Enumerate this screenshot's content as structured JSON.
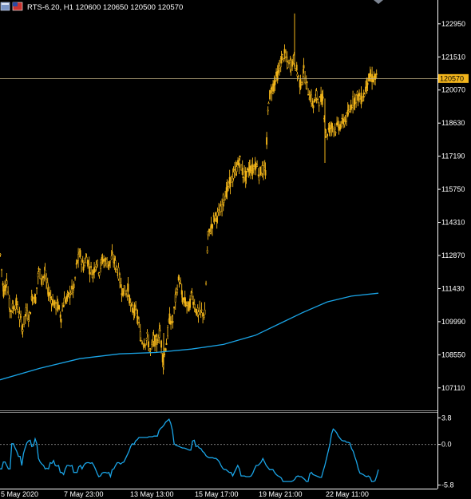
{
  "header": {
    "title": "RTS-6.20, H1  120600 120650 120500 120570",
    "icons": [
      "window-icon",
      "flag-icon"
    ]
  },
  "chart_data": [
    {
      "type": "candlestick",
      "symbol": "RTS-6.20",
      "timeframe": "H1",
      "ohlc": {
        "open": 120600,
        "high": 120650,
        "low": 120500,
        "close": 120570
      },
      "price_axis_ticks": [
        122950,
        121510,
        120070,
        118630,
        117190,
        115750,
        114310,
        112870,
        111430,
        109990,
        108550,
        107110
      ],
      "current_price_label": "120570",
      "current_price": 120570,
      "ylim": [
        106200,
        123500
      ],
      "x_labels": [
        "5 May 2020",
        "7 May 23:00",
        "13 May 13:00",
        "15 May 17:00",
        "19 May 21:00",
        "22 May 11:00"
      ],
      "close_path": [
        [
          0,
          112900
        ],
        [
          4,
          111300
        ],
        [
          8,
          111800
        ],
        [
          12,
          110500
        ],
        [
          16,
          110600
        ],
        [
          20,
          110800
        ],
        [
          24,
          110200
        ],
        [
          28,
          109700
        ],
        [
          32,
          110400
        ],
        [
          36,
          110200
        ],
        [
          40,
          111100
        ],
        [
          44,
          111000
        ],
        [
          48,
          112200
        ],
        [
          52,
          111900
        ],
        [
          56,
          112000
        ],
        [
          60,
          111300
        ],
        [
          64,
          111000
        ],
        [
          68,
          110700
        ],
        [
          72,
          110700
        ],
        [
          76,
          110200
        ],
        [
          80,
          110900
        ],
        [
          84,
          111000
        ],
        [
          88,
          111300
        ],
        [
          92,
          111400
        ],
        [
          96,
          112600
        ],
        [
          100,
          112900
        ],
        [
          104,
          112400
        ],
        [
          108,
          112800
        ],
        [
          112,
          112300
        ],
        [
          116,
          112100
        ],
        [
          120,
          112600
        ],
        [
          124,
          112200
        ],
        [
          128,
          112700
        ],
        [
          132,
          112600
        ],
        [
          136,
          112500
        ],
        [
          140,
          112800
        ],
        [
          144,
          112500
        ],
        [
          148,
          112100
        ],
        [
          152,
          111400
        ],
        [
          156,
          111300
        ],
        [
          160,
          111400
        ],
        [
          164,
          110500
        ],
        [
          168,
          110500
        ],
        [
          172,
          110200
        ],
        [
          176,
          109200
        ],
        [
          180,
          109100
        ],
        [
          184,
          109300
        ],
        [
          188,
          108700
        ],
        [
          192,
          109200
        ],
        [
          196,
          109100
        ],
        [
          200,
          109600
        ],
        [
          204,
          108200
        ],
        [
          208,
          109100
        ],
        [
          212,
          110100
        ],
        [
          216,
          110000
        ],
        [
          220,
          111200
        ],
        [
          224,
          111900
        ],
        [
          228,
          111000
        ],
        [
          232,
          110800
        ],
        [
          236,
          110600
        ],
        [
          240,
          111200
        ],
        [
          244,
          110600
        ],
        [
          248,
          110300
        ],
        [
          252,
          110400
        ],
        [
          256,
          110300
        ],
        [
          260,
          113700
        ],
        [
          264,
          114100
        ],
        [
          268,
          114500
        ],
        [
          272,
          114600
        ],
        [
          276,
          114800
        ],
        [
          280,
          115400
        ],
        [
          284,
          115700
        ],
        [
          288,
          116100
        ],
        [
          292,
          116300
        ],
        [
          296,
          116700
        ],
        [
          300,
          117000
        ],
        [
          304,
          116400
        ],
        [
          308,
          116300
        ],
        [
          312,
          116700
        ],
        [
          316,
          116600
        ],
        [
          320,
          116900
        ],
        [
          324,
          116400
        ],
        [
          328,
          116600
        ],
        [
          332,
          116500
        ],
        [
          336,
          119700
        ],
        [
          340,
          120100
        ],
        [
          344,
          120500
        ],
        [
          348,
          120800
        ],
        [
          352,
          121400
        ],
        [
          356,
          121600
        ],
        [
          360,
          121200
        ],
        [
          364,
          121200
        ],
        [
          368,
          121400
        ],
        [
          372,
          120800
        ],
        [
          376,
          120300
        ],
        [
          380,
          120900
        ],
        [
          384,
          120200
        ],
        [
          388,
          119800
        ],
        [
          392,
          119400
        ],
        [
          396,
          119800
        ],
        [
          400,
          119600
        ],
        [
          404,
          119700
        ],
        [
          408,
          118100
        ],
        [
          412,
          118400
        ],
        [
          416,
          118500
        ],
        [
          420,
          118400
        ],
        [
          424,
          118500
        ],
        [
          428,
          118600
        ],
        [
          432,
          118800
        ],
        [
          436,
          119000
        ],
        [
          440,
          119500
        ],
        [
          444,
          119700
        ],
        [
          448,
          119800
        ],
        [
          452,
          119700
        ],
        [
          456,
          119900
        ],
        [
          460,
          120500
        ],
        [
          464,
          120600
        ],
        [
          468,
          120570
        ],
        [
          472,
          120570
        ]
      ],
      "ma_path": [
        [
          0,
          107460
        ],
        [
          50,
          107960
        ],
        [
          100,
          108380
        ],
        [
          150,
          108590
        ],
        [
          195,
          108650
        ],
        [
          240,
          108800
        ],
        [
          280,
          109000
        ],
        [
          320,
          109400
        ],
        [
          350,
          109900
        ],
        [
          380,
          110400
        ],
        [
          410,
          110850
        ],
        [
          440,
          111100
        ],
        [
          474,
          111230
        ]
      ]
    },
    {
      "type": "line",
      "panel": "oscillator",
      "ticks": [
        3.8,
        0.0,
        -5.8
      ],
      "ylim": [
        -6.2,
        4.3
      ],
      "levels": [
        0.0
      ],
      "series": [
        {
          "values": [
            -3.5,
            -3.5,
            -2.5,
            -2.5,
            -3.0,
            -3.5,
            -3.5,
            0.1,
            0.1,
            -0.5,
            -1.0,
            -1.7,
            -1.7,
            -3.0,
            -1.3,
            -0.5,
            0.2,
            0.5,
            0.6,
            -0.3,
            -0.2,
            0.8,
            0.1,
            -2.0,
            -2.5,
            -2.8,
            -3.0,
            -3.5,
            -3.4,
            -3.5,
            -2.6,
            -2.7,
            -2.3,
            -3.0,
            -3.1,
            -3.0,
            -4.0,
            -4.0,
            -4.3,
            -3.5,
            -3.0,
            -3.0,
            -3.1,
            -3.0,
            -4.0,
            -4.0,
            -4.0,
            -3.2,
            -3.0,
            -3.5,
            -3.0,
            -2.7,
            -2.6,
            -2.6,
            -2.7,
            -2.6,
            -3.0,
            -3.5,
            -4.1,
            -4.6,
            -4.5,
            -4.1,
            -4.0,
            -4.0,
            -4.1,
            -4.0,
            -4.6,
            -3.6,
            -3.5,
            -3.0,
            -2.6,
            -2.6,
            -2.8,
            -2.6,
            -2.5,
            -2.0,
            -1.5,
            -1.0,
            -0.3,
            0.1,
            0.0,
            0.5,
            0.7,
            1.0,
            1.0,
            1.0,
            1.0,
            1.0,
            1.0,
            1.1,
            1.1,
            1.1,
            1.2,
            1.2,
            1.2,
            2.0,
            2.3,
            2.5,
            2.8,
            3.2,
            3.4,
            3.6,
            3.0,
            2.0,
            0.1,
            -0.1,
            -0.2,
            -0.3,
            -0.4,
            -0.5,
            -0.5,
            -0.6,
            -0.7,
            -0.8,
            -0.8,
            0.5,
            0.6,
            -0.3,
            -0.2,
            -0.5,
            -0.6,
            -1.0,
            -1.2,
            -1.6,
            -1.8,
            -1.9,
            -1.9,
            -1.9,
            -2.0,
            -2.0,
            -2.2,
            -2.5,
            -3.0,
            -3.4,
            -3.6,
            -3.6,
            -3.8,
            -4.0,
            -4.0,
            -4.5,
            -4.0,
            -3.5,
            -3.0,
            -3.5,
            -4.5,
            -4.5,
            -4.5,
            -4.6,
            -4.6,
            -4.6,
            -4.5,
            -4.1,
            -3.5,
            -3.0,
            -3.0,
            -2.8,
            -2.5,
            -2.0,
            -2.5,
            -3.0,
            -3.3,
            -3.6,
            -3.6,
            -3.6,
            -4.0,
            -4.3,
            -4.5,
            -4.6,
            -4.8,
            -5.3,
            -5.3,
            -5.3,
            -5.3,
            -5.3,
            -5.3,
            -5.2,
            -5.0,
            -4.6,
            -4.5,
            -4.6,
            -4.6,
            -4.8,
            -5.0,
            -5.3,
            -5.3,
            -4.2,
            -4.0,
            -4.3,
            -4.4,
            -4.5,
            -4.6,
            -4.7,
            -4.7,
            -3.8,
            -3.0,
            -2.0,
            -1.0,
            0.0,
            1.5,
            2.2,
            2.0,
            1.7,
            1.2,
            0.9,
            0.6,
            0.5,
            0.5,
            0.3,
            0.3,
            0.2,
            -0.6,
            -1.0,
            -1.8,
            -2.5,
            -3.5,
            -4.1,
            -4.2,
            -4.3,
            -4.5,
            -4.6,
            -4.5,
            -4.7,
            -5.3,
            -5.3,
            -5.2,
            -4.5,
            -3.6
          ]
        }
      ]
    }
  ]
}
